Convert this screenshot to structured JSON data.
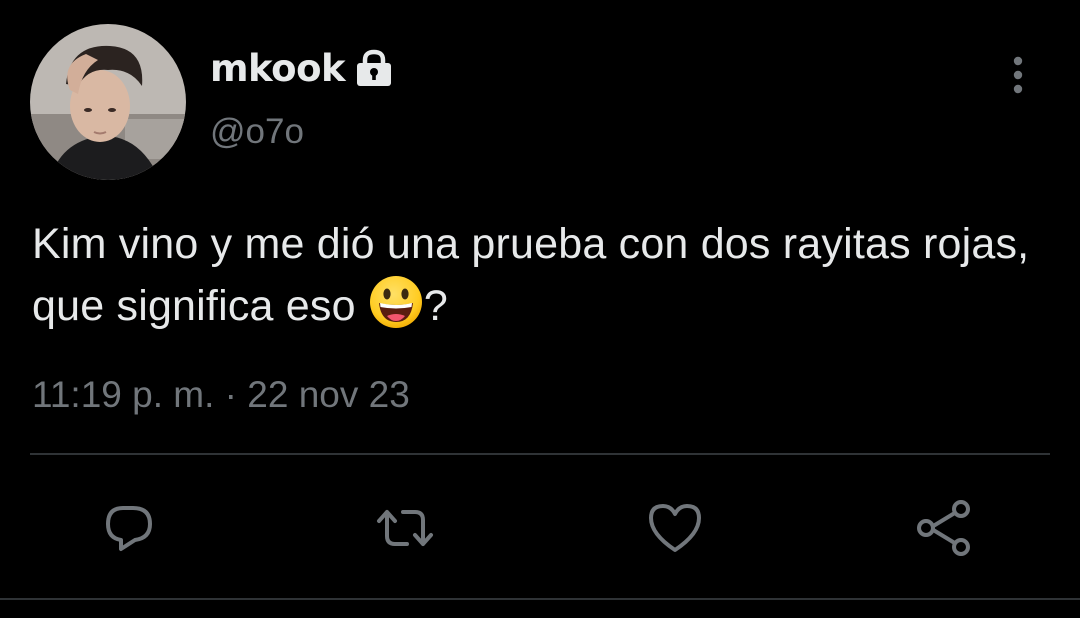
{
  "author": {
    "display_name": "mkook",
    "handle": "@o7o",
    "protected_icon": "lock-icon",
    "avatar_icon": "profile-photo"
  },
  "tweet": {
    "text_before_emoji": "Kim vino y me dió una prueba con dos rayitas rojas, que significa eso ",
    "emoji_icon": "grinning-face-emoji",
    "text_after_emoji": "?",
    "time": "11:19 p. m.",
    "separator": "·",
    "date": "22 nov 23"
  },
  "actions": [
    {
      "name": "reply",
      "icon": "reply-icon"
    },
    {
      "name": "retweet",
      "icon": "retweet-icon"
    },
    {
      "name": "like",
      "icon": "heart-icon"
    },
    {
      "name": "share",
      "icon": "share-icon"
    }
  ],
  "more_menu_icon": "more-vertical-icon",
  "colors": {
    "background": "#000000",
    "primary_text": "#e7e9ea",
    "secondary_text": "#71767b",
    "divider": "#2f3336"
  }
}
